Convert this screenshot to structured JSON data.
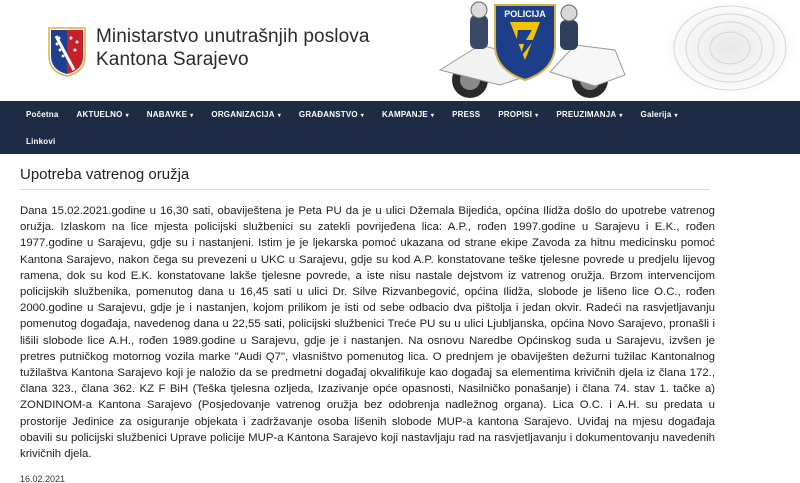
{
  "header": {
    "title_line1": "Ministarstvo unutrašnjih poslova",
    "title_line2": "Kantona Sarajevo",
    "hero_badge_text": "POLICIJA"
  },
  "nav": {
    "items": [
      {
        "label": "Početna",
        "dropdown": false
      },
      {
        "label": "AKTUELNO",
        "dropdown": true
      },
      {
        "label": "NABAVKE",
        "dropdown": true
      },
      {
        "label": "ORGANIZACIJA",
        "dropdown": true
      },
      {
        "label": "GRAĐANSTVO",
        "dropdown": true
      },
      {
        "label": "KAMPANJE",
        "dropdown": true
      },
      {
        "label": "PRESS",
        "dropdown": false
      },
      {
        "label": "PROPISI",
        "dropdown": true
      },
      {
        "label": "PREUZIMANJA",
        "dropdown": true
      },
      {
        "label": "Galerija",
        "dropdown": true
      }
    ],
    "second_row": [
      {
        "label": "Linkovi",
        "dropdown": false
      }
    ]
  },
  "article": {
    "title": "Upotreba vatrenog oružja",
    "body": "Dana 15.02.2021.godine u 16,30 sati, obaviještena je Peta PU da je u ulici Džemala Bijedića, općina Ilidža došlo do upotrebe vatrenog oružja. Izlaskom na lice mjesta policijski službenici su zatekli povrijeđena lica: A.P., rođen 1997.godine u Sarajevu i E.K., rođen 1977.godine u Sarajevu, gdje su i nastanjeni. Istim je je ljekarska pomoć ukazana od strane ekipe Zavoda za hitnu medicinsku pomoć Kantona Sarajevo, nakon čega su prevezeni u UKC u Sarajevu, gdje su kod A.P. konstatovane teške tjelesne povrede u predjelu lijevog ramena, dok su kod E.K. konstatovane lakše tjelesne povrede, a iste nisu nastale dejstvom iz vatrenog oružja. Brzom intervencijom policijskih službenika, pomenutog dana u 16,45 sati u ulici Dr. Silve Rizvanbegović, općina Ilidža, slobode je lišeno lice O.C., rođen 2000.godine u Sarajevu, gdje je i nastanjen, kojom prilikom je isti od sebe odbacio dva pištolja i jedan okvir. Radeći na rasvjetljavanju pomenutog događaja, navedenog dana u 22,55 sati, policijski službenici Treće PU su u ulici Ljubljanska, općina Novo Sarajevo, pronašli i lišili slobode lice A.H., rođen 1989.godine u Sarajevu, gdje je i nastanjen. Na osnovu Naredbe Općinskog suda u Sarajevu, izvšen je pretres putničkog motornog vozila marke \"Audi Q7\", vlasništvo pomenutog lica. O prednjem je obaviješten dežurni tužilac Kantonalnog tužilaštva Kantona Sarajevo koji je naložio da se predmetni događaj okvalifikuje kao događaj sa elementima krivičnih djela iz člana 172., člana 323., člana 362. KZ F BiH (Teška tjelesna ozljeda, Izazivanje opće opasnosti, Nasilničko ponašanje) i člana 74. stav 1. tačke a) ZONDINOM-a Kantona Sarajevo (Posjedovanje vatrenog oružja bez odobrenja nadležnog organa). Lica O.C. i A.H. su predata u prostorije Jedinice za osiguranje objekata i zadržavanje osoba lišenih slobode MUP-a kantona Sarajevo. Uviđaj na mjesu događaja obavili su policijski službenici Uprave policije MUP-a Kantona Sarajevo koji nastavljaju rad na rasvjetljavanju i dokumentovanju navedenih krivičnih djela.",
    "date": "16.02.2021"
  },
  "colors": {
    "nav_bg": "#1d2b45",
    "shield_red": "#c7202b",
    "shield_blue": "#1f3f8f",
    "shield_gold": "#d9b24a"
  }
}
